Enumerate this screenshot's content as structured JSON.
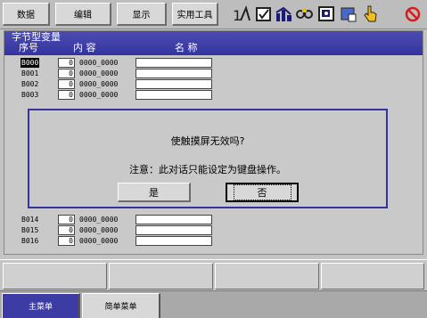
{
  "menu": {
    "data_label": "数据",
    "edit_label": "编辑",
    "display_label": "显示",
    "utility_label": "实用工具"
  },
  "toolbar_icons": [
    "job-selection-icon",
    "check-box-icon",
    "chart-icon",
    "tool-link-icon",
    "display-window-icon",
    "screen-layout-icon",
    "touch-hand-icon",
    "prohibit-icon"
  ],
  "panel": {
    "title": "字节型变量",
    "col_no": "序号",
    "col_content": "内 容",
    "col_name": "名 称"
  },
  "rows_top": [
    {
      "id": "B000",
      "value": "0",
      "binary": "0000_0000"
    },
    {
      "id": "B001",
      "value": "0",
      "binary": "0000_0000"
    },
    {
      "id": "B002",
      "value": "0",
      "binary": "0000_0000"
    },
    {
      "id": "B003",
      "value": "0",
      "binary": "0000_0000"
    }
  ],
  "rows_bottom": [
    {
      "id": "B014",
      "value": "0",
      "binary": "0000_0000"
    },
    {
      "id": "B015",
      "value": "0",
      "binary": "0000_0000"
    },
    {
      "id": "B016",
      "value": "0",
      "binary": "0000_0000"
    }
  ],
  "dialog": {
    "message": "使触摸屏无效吗?",
    "note": "注意：此对话只能设定为键盘操作。",
    "yes_label": "是",
    "no_label": "否"
  },
  "tabs": {
    "main_menu": "主菜单",
    "simple_menu": "简单菜单"
  },
  "colors": {
    "header_blue": "#3c3ca8",
    "dialog_border": "#34349c",
    "active_tab": "#3c3ca4",
    "prohibit_red": "#d21e1e"
  }
}
